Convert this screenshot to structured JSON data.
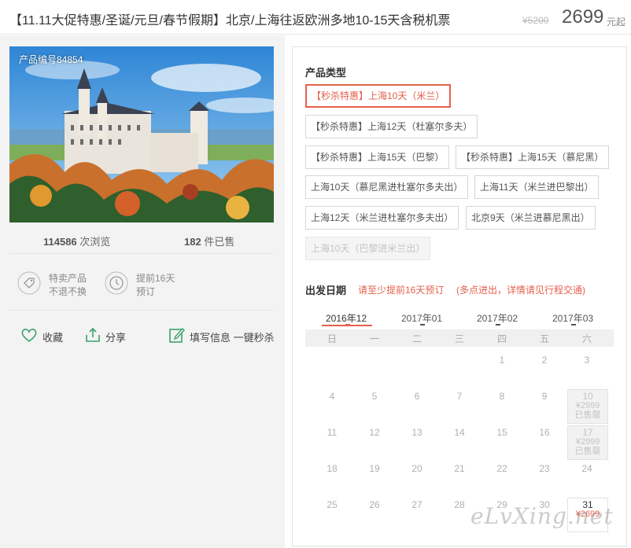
{
  "header": {
    "title": "【11.11大促特惠/圣诞/元旦/春节假期】北京/上海往返欧洲多地10-15天含税机票",
    "old_price": "¥5200",
    "price": "2699",
    "price_unit": "元起"
  },
  "product": {
    "number_label": "产品编号84854",
    "views": "114586",
    "views_label": "次浏览",
    "sold": "182",
    "sold_label": "件已售"
  },
  "features": [
    {
      "icon": "tag-icon",
      "line1": "特卖产品",
      "line2": "不退不换"
    },
    {
      "icon": "clock-icon",
      "line1": "提前16天",
      "line2": "预订"
    }
  ],
  "actions": {
    "favorite": "收藏",
    "share": "分享",
    "book": "填写信息 一键秒杀"
  },
  "product_type": {
    "title": "产品类型",
    "options": [
      "【秒杀特惠】上海10天（米兰）",
      "【秒杀特惠】上海12天（杜塞尔多夫）",
      "【秒杀特惠】上海15天（巴黎）",
      "【秒杀特惠】上海15天（慕尼黑）",
      "上海10天（慕尼黑进杜塞尔多夫出）",
      "上海11天（米兰进巴黎出）",
      "上海12天（米兰进杜塞尔多夫出）",
      "北京9天（米兰进慕尼黑出）",
      "上海10天（巴黎进米兰出）"
    ],
    "selected_index": 0,
    "disabled_index": 8
  },
  "departure": {
    "title": "出发日期",
    "tip1": "请至少提前16天预订",
    "tip2": "(多点进出，详情请见行程交通)"
  },
  "calendar": {
    "months": [
      "2016年12",
      "2017年01",
      "2017年02",
      "2017年03"
    ],
    "active_month": 0,
    "weekdays": [
      "日",
      "一",
      "二",
      "三",
      "四",
      "五",
      "六"
    ],
    "rows": [
      [
        "",
        "",
        "",
        "",
        "1",
        "2",
        "3"
      ],
      [
        "4",
        "5",
        "6",
        "7",
        "8",
        "9",
        "10"
      ],
      [
        "11",
        "12",
        "13",
        "14",
        "15",
        "16",
        "17"
      ],
      [
        "18",
        "19",
        "20",
        "21",
        "22",
        "23",
        "24"
      ],
      [
        "25",
        "26",
        "27",
        "28",
        "29",
        "30",
        "31"
      ]
    ],
    "special": [
      {
        "date": "10",
        "price": "¥2999",
        "status": "已售罄"
      },
      {
        "date": "17",
        "price": "¥2999",
        "status": "已售罄"
      },
      {
        "date": "31",
        "price": "¥2699",
        "status": ""
      }
    ]
  },
  "watermark": "eLvXing.net",
  "colors": {
    "accent": "#e6604d",
    "panel_bg": "#f3f3f3",
    "icon_green": "#3aa36b"
  }
}
